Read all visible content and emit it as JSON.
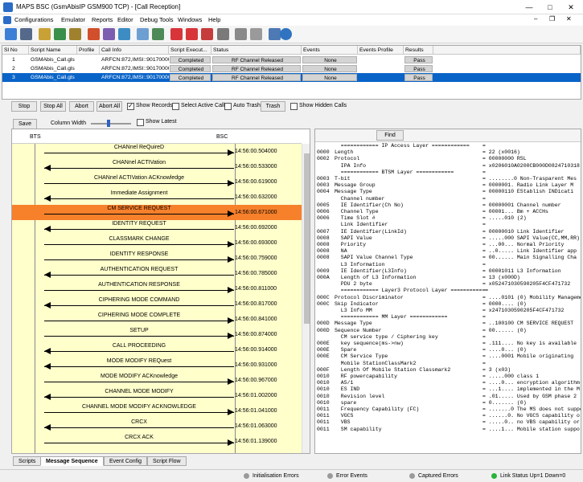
{
  "window": {
    "title": "MAPS BSC (GsmAbisIP GSM900 TCP) - [Call Reception]",
    "min": "—",
    "max": "□",
    "close": "✕",
    "sub_min": "–",
    "sub_restore": "❐",
    "sub_close": "✕"
  },
  "menu": [
    "Configurations",
    "Emulator",
    "Reports",
    "Editor",
    "Debug Tools",
    "Windows",
    "Help"
  ],
  "toolbar_icons": [
    "gear-icon",
    "notebook-icon",
    "script-icon",
    "flag-icon",
    "people-icon",
    "cube-icon",
    "wizard-icon",
    "checklist-icon",
    "stop-doc-icon",
    "pause-doc-icon",
    "tools-icon",
    "adjust-icon",
    "list-icon",
    "grid-icon",
    "help-icon",
    "refresh-icon"
  ],
  "grid": {
    "headers": [
      "Sl No",
      "Script Name",
      "Profile",
      "Call Info",
      "Script Execut...",
      "Status",
      "Events",
      "Events Profile",
      "Results"
    ],
    "rows": [
      {
        "sl": "1",
        "script": "GSMAbis_Call.gls",
        "profile": "",
        "callinfo": "ARFCN:872,IMSI::90170000...",
        "exec": "Completed",
        "status": "RF Channel Released",
        "events": "None",
        "eprofile": "",
        "result": "Pass"
      },
      {
        "sl": "2",
        "script": "GSMAbis_Call.gls",
        "profile": "",
        "callinfo": "ARFCN:872,IMSI::90170000...",
        "exec": "Completed",
        "status": "RF Channel Released",
        "events": "None",
        "eprofile": "",
        "result": "Pass"
      },
      {
        "sl": "3",
        "script": "GSMAbis_Call.gls",
        "profile": "",
        "callinfo": "ARFCN:872,IMSI::90170000...",
        "exec": "Completed",
        "status": "RF Channel Released",
        "events": "None",
        "eprofile": "",
        "result": "Pass"
      }
    ]
  },
  "actions": {
    "stop": "Stop",
    "stop_all": "Stop All",
    "abort": "Abort",
    "abort_all": "Abort All",
    "show_records": "Show Records",
    "select_active": "Select Active Call",
    "auto_trash": "Auto Trash",
    "trash": "Trash",
    "show_hidden": "Show Hidden Calls"
  },
  "pane_controls": {
    "save": "Save",
    "column_width": "Column Width",
    "show_latest": "Show Latest",
    "find": "Find"
  },
  "sequence": {
    "left_entity": "BTS",
    "right_entity": "BSC",
    "messages": [
      {
        "label": "CHANnel ReQuireD",
        "time": "14:56:00.504000",
        "dir": "r"
      },
      {
        "label": "CHANnel ACTIVation",
        "time": "14:56:00.533000",
        "dir": "l"
      },
      {
        "label": "CHANnel ACTIVation ACKnowledge",
        "time": "14:56:00.619000",
        "dir": "r"
      },
      {
        "label": "Immediate Assignment",
        "time": "14:56:00.632000",
        "dir": "l"
      },
      {
        "label": "CM SERVICE REQUEST",
        "time": "14:56:00.671000",
        "dir": "r",
        "hl": true
      },
      {
        "label": "IDENTITY REQUEST",
        "time": "14:56:00.692000",
        "dir": "l"
      },
      {
        "label": "CLASSMARK CHANGE",
        "time": "14:56:00.693000",
        "dir": "r"
      },
      {
        "label": "IDENTITY RESPONSE",
        "time": "14:56:00.759000",
        "dir": "r"
      },
      {
        "label": "AUTHENTICATION REQUEST",
        "time": "14:56:00.785000",
        "dir": "l"
      },
      {
        "label": "AUTHENTICATION RESPONSE",
        "time": "14:56:00.811000",
        "dir": "r"
      },
      {
        "label": "CIPHERING MODE COMMAND",
        "time": "14:56:00.817000",
        "dir": "l"
      },
      {
        "label": "CIPHERING MODE COMPLETE",
        "time": "14:56:00.841000",
        "dir": "r"
      },
      {
        "label": "SETUP",
        "time": "14:56:00.874000",
        "dir": "r"
      },
      {
        "label": "CALL PROCEEDING",
        "time": "14:56:00.914000",
        "dir": "l"
      },
      {
        "label": "MODE MODIFY REQuest",
        "time": "14:56:00.931000",
        "dir": "l"
      },
      {
        "label": "MODE MODIFY ACKnowledge",
        "time": "14:56:00.967000",
        "dir": "r"
      },
      {
        "label": "CHANNEL MODE MODIFY",
        "time": "14:56:01.002000",
        "dir": "l"
      },
      {
        "label": "CHANNEL MODE MODIFY ACKNOWLEDGE",
        "time": "14:56:01.041000",
        "dir": "r"
      },
      {
        "label": "CRCX",
        "time": "14:56:01.063000",
        "dir": "l"
      },
      {
        "label": "CRCX ACK",
        "time": "14:56:01.139000",
        "dir": "r"
      }
    ]
  },
  "decode": [
    [
      "",
      "  ============ IP Access Layer ============",
      "="
    ],
    [
      "0000",
      "Length",
      "= 22 (x0016)"
    ],
    [
      "0002",
      "Protocol",
      "= 00000000 RSL"
    ],
    [
      "",
      "  IPA Info",
      "= x0206010A0200CB000D0824710318"
    ],
    [
      "",
      "  ============ BTSM Layer ============",
      "="
    ],
    [
      "0003",
      "T-bit",
      "= ........0 Non-Trasparent Mes"
    ],
    [
      "0003",
      "Message Group",
      "= 0000001. Radio Link Layer M"
    ],
    [
      "0004",
      "Message Type",
      "= 00000110 EStablish INDicati"
    ],
    [
      "",
      "  Channel number",
      "="
    ],
    [
      "0005",
      "  IE Identifier(Ch No)",
      "= 00000001 Channel number"
    ],
    [
      "0006",
      "  Channel Type",
      "= 00001... Bm + ACCHs"
    ],
    [
      "0006",
      "  Time Slot #",
      "= .....010 (2)"
    ],
    [
      "",
      "  Link Identifier",
      "="
    ],
    [
      "0007",
      "  IE Identifier(LinkId)",
      "= 00000010 Link Identifier"
    ],
    [
      "0008",
      "  SAPI Value",
      "= .....000 SAPI Value(CC,MM,RR)"
    ],
    [
      "0008",
      "  Priority",
      "= ...00... Normal Priority"
    ],
    [
      "0008",
      "  NA",
      "= ..0..... Link Identifier app"
    ],
    [
      "0008",
      "  SAPI Value Channel Type",
      "= 00...... Main Signalling Cha"
    ],
    [
      "",
      "  L3 Information",
      "="
    ],
    [
      "0009",
      "  IE Identifier(L3Info)",
      "= 00001011 L3 Information"
    ],
    [
      "000A",
      "  Length of L3 Information",
      "= 13 (x000D)"
    ],
    [
      "",
      "  PDU 2 byte",
      "= x052471030590205F4CF471732"
    ],
    [
      "",
      "  ============ Layer3 Protocol Layer ============",
      "="
    ],
    [
      "000C",
      "Protocol Discriminator",
      "= ....0101 (0) Mobility Management"
    ],
    [
      "000C",
      "Skip Indicator",
      "= 0000.... (0)"
    ],
    [
      "",
      "  L3 Info MM",
      "= x2471030590205F4CF471732"
    ],
    [
      "",
      "  ============ MM Layer ============",
      "="
    ],
    [
      "000D",
      "Message Type",
      "= ..100100 CM SERVICE REQUEST"
    ],
    [
      "000D",
      "Sequence Number",
      "= 00...... (0)"
    ],
    [
      "",
      "  CM service type / Ciphering key",
      "="
    ],
    [
      "000E",
      "  key sequence(ms->nw)",
      "= .111.... No key is available"
    ],
    [
      "000E",
      "  Spare",
      "= ....0... (0)"
    ],
    [
      "000E",
      "  CM Service Type",
      "= ....0001 Mobile originating"
    ],
    [
      "",
      "  Mobile StationClassMark2",
      "="
    ],
    [
      "000F",
      "  Length Of Mobile Station Classmark2",
      "= 3 (x03)"
    ],
    [
      "0010",
      "  RF powercapability",
      "= .....000 class 1"
    ],
    [
      "0010",
      "  A5/1",
      "= ....0... encryption algorithm"
    ],
    [
      "0010",
      "  ES IND",
      "= ...1.... implemented in the M"
    ],
    [
      "0010",
      "  Revision level",
      "= .01..... Used by GSM phase 2"
    ],
    [
      "0010",
      "  spare",
      "= 0....... (0)"
    ],
    [
      "0011",
      "  Frequency Capability (FC)",
      "= .......0 The MS does not suppo"
    ],
    [
      "0011",
      "  VGCS",
      "= ......0. No VGCS capability o"
    ],
    [
      "0011",
      "  VBS",
      "= .....0.. no VBS capability or"
    ],
    [
      "0011",
      "  SM capability",
      "= ....1... Mobile station suppo"
    ]
  ],
  "tabs": [
    "Scripts",
    "Message Sequence",
    "Event Config",
    "Script Flow"
  ],
  "status": [
    "Initialisation Errors",
    "Error Events",
    "Captured Errors",
    "Link Status Up=1 Down=0"
  ]
}
